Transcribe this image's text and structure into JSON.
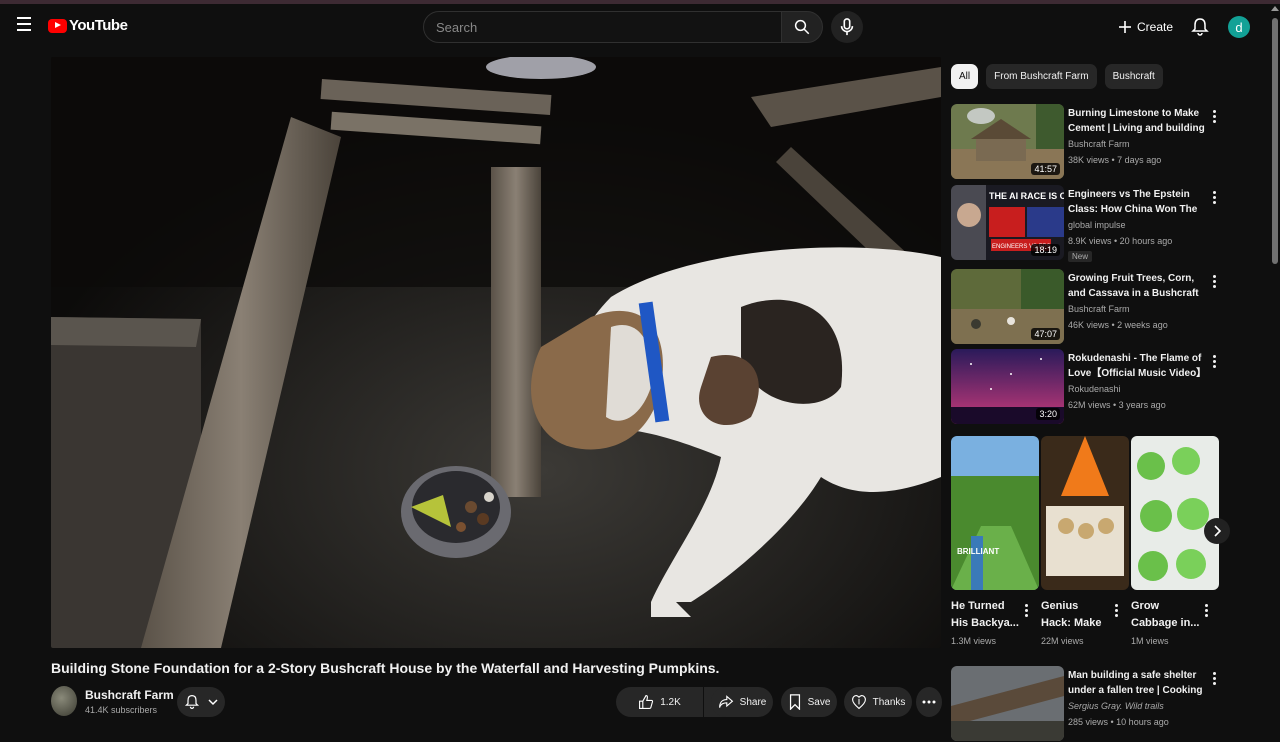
{
  "header": {
    "logo_text": "YouTube",
    "search_placeholder": "Search",
    "create_label": "Create",
    "account_initial": "d"
  },
  "video": {
    "title": "Building Stone Foundation for a 2-Story Bushcraft House by the Waterfall and Harvesting Pumpkins.",
    "channel": "Bushcraft Farm",
    "subscribers": "41.4K subscribers",
    "likes": "1.2K",
    "share_label": "Share",
    "save_label": "Save",
    "thanks_label": "Thanks"
  },
  "chips": [
    "All",
    "From Bushcraft Farm",
    "Bushcraft"
  ],
  "recommendations": [
    {
      "title": "Burning Limestone to Make Cement | Living and building a ...",
      "channel": "Bushcraft Farm",
      "meta": "38K views • 7 days ago",
      "duration": "41:57",
      "badge": ""
    },
    {
      "title": "Engineers vs The Epstein Class: How China Won The AI Race ...",
      "channel": "global impulse",
      "meta": "8.9K views • 20 hours ago",
      "duration": "18:19",
      "badge": "New",
      "thumb_text": "THE AI RACE IS OVER",
      "thumb_sub": "ENGINEERS VS EPS"
    },
    {
      "title": "Growing Fruit Trees, Corn, and Cassava in a Bushcraft Farm | ...",
      "channel": "Bushcraft Farm",
      "meta": "46K views • 2 weeks ago",
      "duration": "47:07",
      "badge": ""
    },
    {
      "title": "Rokudenashi - The Flame of Love【Official Music Video】",
      "channel": "Rokudenashi",
      "meta": "62M views • 3 years ago",
      "duration": "3:20",
      "badge": ""
    }
  ],
  "shorts": [
    {
      "title": "He Turned His Backya...",
      "views": "1.3M views",
      "thumb_text": "BRILLIANT"
    },
    {
      "title": "Genius Hack: Make ...",
      "views": "22M views"
    },
    {
      "title": "Grow Cabbage in...",
      "views": "1M views"
    }
  ],
  "recommendation_bottom": {
    "title": "Man building a safe shelter under a fallen tree | Cooking ...",
    "channel": "Sergius Gray. Wild trails",
    "meta": "285 views • 10 hours ago"
  }
}
